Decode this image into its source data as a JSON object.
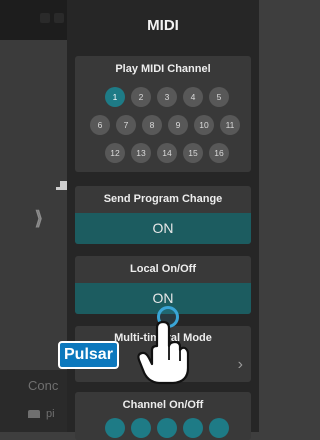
{
  "background": {
    "concert_label": "Conc",
    "piano_label": "pi"
  },
  "panel": {
    "title": "MIDI",
    "play_midi_channel": {
      "label": "Play MIDI Channel",
      "selected": "1",
      "rows": [
        [
          "1",
          "2",
          "3",
          "4",
          "5"
        ],
        [
          "6",
          "7",
          "8",
          "9",
          "10",
          "11"
        ],
        [
          "12",
          "13",
          "14",
          "15",
          "16"
        ]
      ]
    },
    "send_program_change": {
      "label": "Send Program Change",
      "value": "ON"
    },
    "local_on_off": {
      "label": "Local On/Off",
      "value": "ON"
    },
    "multi_timbral_mode": {
      "label": "Multi-timbral Mode"
    },
    "channel_on_off": {
      "label": "Channel On/Off"
    }
  },
  "overlay": {
    "tap_label": "Pulsar"
  },
  "colors": {
    "accent": "#1e7b86",
    "toggle_on": "#1c5c60",
    "tap_blue": "#0c78bd"
  }
}
